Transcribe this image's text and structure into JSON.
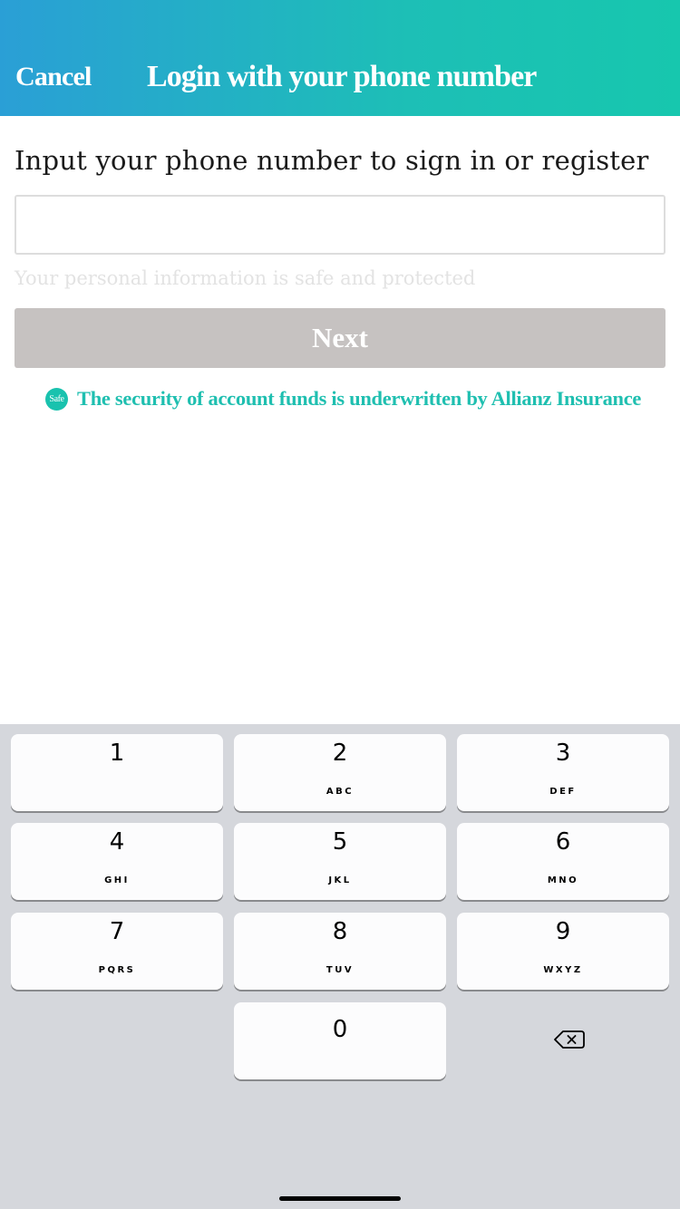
{
  "header": {
    "cancel_label": "Cancel",
    "title": "Login with your phone number"
  },
  "form": {
    "prompt": "Input your phone number to sign in or register",
    "phone_value": "",
    "phone_placeholder": "",
    "privacy_note": "Your personal information is safe and protected",
    "next_label": "Next"
  },
  "security": {
    "badge_text": "Safe",
    "text": "The security of account funds is underwritten by Allianz Insurance"
  },
  "keypad": {
    "keys": [
      {
        "digit": "1",
        "letters": ""
      },
      {
        "digit": "2",
        "letters": "ABC"
      },
      {
        "digit": "3",
        "letters": "DEF"
      },
      {
        "digit": "4",
        "letters": "GHI"
      },
      {
        "digit": "5",
        "letters": "JKL"
      },
      {
        "digit": "6",
        "letters": "MNO"
      },
      {
        "digit": "7",
        "letters": "PQRS"
      },
      {
        "digit": "8",
        "letters": "TUV"
      },
      {
        "digit": "9",
        "letters": "WXYZ"
      },
      {
        "digit": "0",
        "letters": ""
      }
    ],
    "delete_icon": "backspace-icon"
  },
  "colors": {
    "header_gradient_start": "#2a9fd6",
    "header_gradient_end": "#17c7ae",
    "accent": "#1fbfb0",
    "button_disabled": "#c6c2c1"
  }
}
